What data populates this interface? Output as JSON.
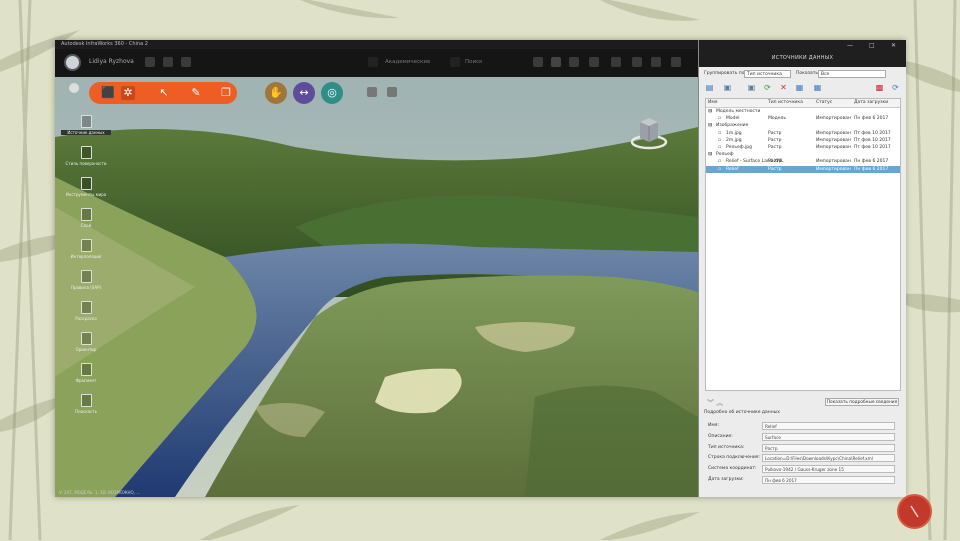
{
  "window": {
    "title": "Autodesk InfraWorks 360 - China 2",
    "user": "Lidiya Ryzhova",
    "toolbar_items": [
      "Академические",
      "Поиск"
    ]
  },
  "left_tools": [
    {
      "label": "Источник данных"
    },
    {
      "label": "Стиль поверхности"
    },
    {
      "label": "Инструменты мира"
    },
    {
      "label": "Слой"
    },
    {
      "label": "Интерполяция"
    },
    {
      "label": "Правила (SAP)"
    },
    {
      "label": "Раскраска"
    },
    {
      "label": "Ориентир"
    },
    {
      "label": "Фрагмент"
    },
    {
      "label": "Плоскость"
    }
  ],
  "status_bar": "V: 247, МОДЕЛЬ: 1, 3D: ВОЗМОЖНО, ...",
  "panel": {
    "title": "ИСТОЧНИКИ ДАННЫХ",
    "group_by_label": "Группировать по:",
    "group_by_value": "Тип источника",
    "show_label": "Показать:",
    "show_value": "Все",
    "columns": [
      "Имя",
      "Тип источника",
      "Статус",
      "Дата загрузки"
    ],
    "rows": [
      {
        "name": "Модель местности",
        "type": "",
        "status": "",
        "date": "",
        "indent": 0,
        "expanded": true
      },
      {
        "name": "Model",
        "type": "Модель",
        "status": "Импортирован",
        "date": "Пн фев 6 2017",
        "indent": 1
      },
      {
        "name": "Изображение",
        "type": "",
        "status": "",
        "date": "",
        "indent": 0,
        "expanded": true
      },
      {
        "name": "1m.jpg",
        "type": "Растр",
        "status": "Импортирован",
        "date": "Пт фев 10 2017",
        "indent": 1
      },
      {
        "name": "2m.jpg",
        "type": "Растр",
        "status": "Импортирован",
        "date": "Пт фев 10 2017",
        "indent": 1
      },
      {
        "name": "Рельеф.jpg",
        "type": "Растр",
        "status": "Импортирован",
        "date": "Пт фев 10 2017",
        "indent": 1
      },
      {
        "name": "Рельеф",
        "type": "",
        "status": "",
        "date": "",
        "indent": 0,
        "expanded": true
      },
      {
        "name": "Relief - Surface Land XML",
        "type": "Растр",
        "status": "Импортирован",
        "date": "Пн фев 6 2017",
        "indent": 1
      },
      {
        "name": "Relief",
        "type": "Растр",
        "status": "Импортирован",
        "date": "Пн фев 6 2017",
        "indent": 1,
        "selected": true
      }
    ],
    "detail_button": "Показать подробные сведения",
    "props_title": "Подробно об источнике данных",
    "props": [
      {
        "label": "Имя:",
        "value": "Relief"
      },
      {
        "label": "Описание:",
        "value": "Surface"
      },
      {
        "label": "Тип источника:",
        "value": "Растр"
      },
      {
        "label": "Строка подключения:",
        "value": "Location=D:\\Files\\Downloads\\Курс\\China\\Relief.xml"
      },
      {
        "label": "Система координат:",
        "value": "Pulkovo-1942 / Gauss-Kruger zone 15"
      },
      {
        "label": "Дата загрузки:",
        "value": "Пн фев 6 2017"
      }
    ]
  },
  "colors": {
    "accent": "#ee5d24",
    "slide_badge": "#c0392b",
    "background": "#dfe1c8"
  }
}
